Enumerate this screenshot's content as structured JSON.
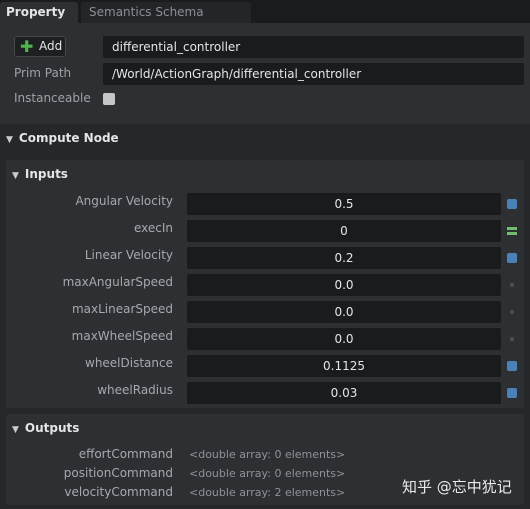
{
  "tabs": [
    {
      "label": "Property"
    },
    {
      "label": "Semantics Schema Editor"
    }
  ],
  "header": {
    "add_label": "Add",
    "prim_name": "differential_controller",
    "prim_path_label": "Prim Path",
    "prim_path": "/World/ActionGraph/differential_controller",
    "instanceable_label": "Instanceable",
    "instanceable_checked": false
  },
  "compute_node": {
    "title": "Compute Node",
    "inputs": {
      "title": "Inputs",
      "rows": [
        {
          "label": "Angular Velocity",
          "value": "0.5",
          "indicator": "blue"
        },
        {
          "label": "execIn",
          "value": "0",
          "indicator": "exec"
        },
        {
          "label": "Linear Velocity",
          "value": "0.2",
          "indicator": "blue"
        },
        {
          "label": "maxAngularSpeed",
          "value": "0.0",
          "indicator": "dot"
        },
        {
          "label": "maxLinearSpeed",
          "value": "0.0",
          "indicator": "dot"
        },
        {
          "label": "maxWheelSpeed",
          "value": "0.0",
          "indicator": "dot"
        },
        {
          "label": "wheelDistance",
          "value": "0.1125",
          "indicator": "blue"
        },
        {
          "label": "wheelRadius",
          "value": "0.03",
          "indicator": "blue"
        }
      ]
    },
    "outputs": {
      "title": "Outputs",
      "rows": [
        {
          "label": "effortCommand",
          "value": "<double array: 0 elements>"
        },
        {
          "label": "positionCommand",
          "value": "<double array: 0 elements>"
        },
        {
          "label": "velocityCommand",
          "value": "<double array: 2 elements>"
        }
      ]
    }
  },
  "watermark": "知乎 @忘中犹记",
  "colors": {
    "accent_blue": "#4a82b8",
    "exec_green": "#6fbf6f",
    "add_green": "#4fb34f"
  }
}
